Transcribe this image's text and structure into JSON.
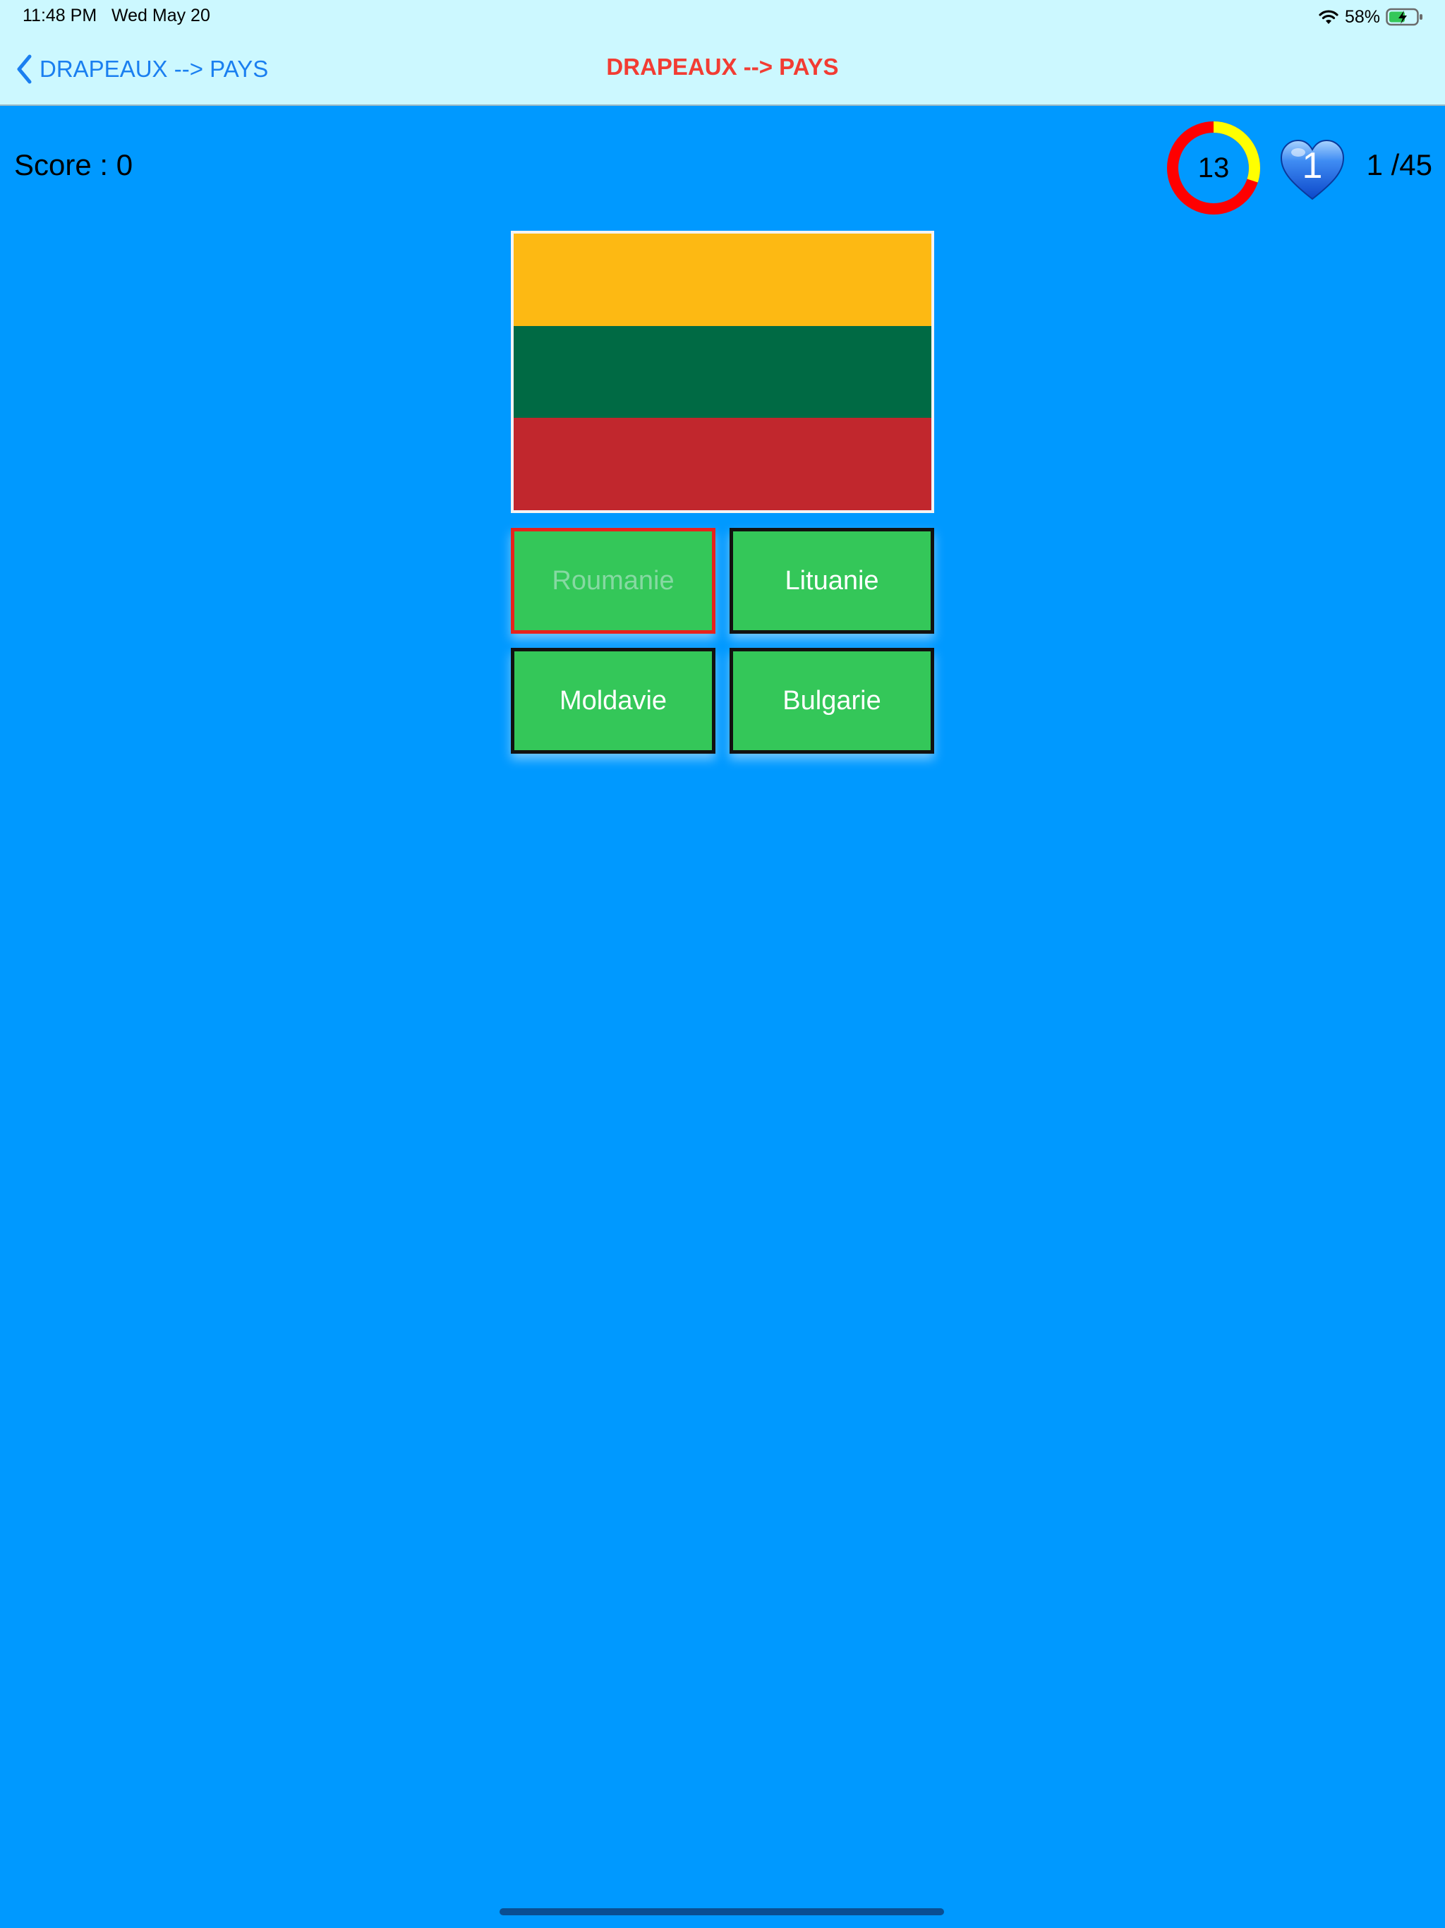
{
  "status_bar": {
    "time": "11:48 PM   Wed May 20",
    "battery_percent": "58%"
  },
  "nav": {
    "back_label": "DRAPEAUX --> PAYS",
    "title": "DRAPEAUX --> PAYS"
  },
  "game": {
    "score_text": "Score : 0",
    "timer_value": "13",
    "timer_elapsed_fraction": 0.3,
    "lives_value": "1",
    "question_counter": "1 /45"
  },
  "flag": {
    "icon": "flag-lithuania",
    "stripes": [
      "#fdb913",
      "#006a44",
      "#c1272d"
    ]
  },
  "answers": [
    {
      "label": "Roumanie",
      "state": "wrong"
    },
    {
      "label": "Lituanie",
      "state": "default"
    },
    {
      "label": "Moldavie",
      "state": "default"
    },
    {
      "label": "Bulgarie",
      "state": "default"
    }
  ],
  "colors": {
    "background": "#0099ff",
    "nav_background": "#ccf8ff",
    "nav_title": "#f23c33",
    "back_link": "#1a7ff0",
    "answer_fill": "#34c759",
    "timer_remaining": "#ff0000",
    "timer_elapsed": "#ffff00"
  }
}
